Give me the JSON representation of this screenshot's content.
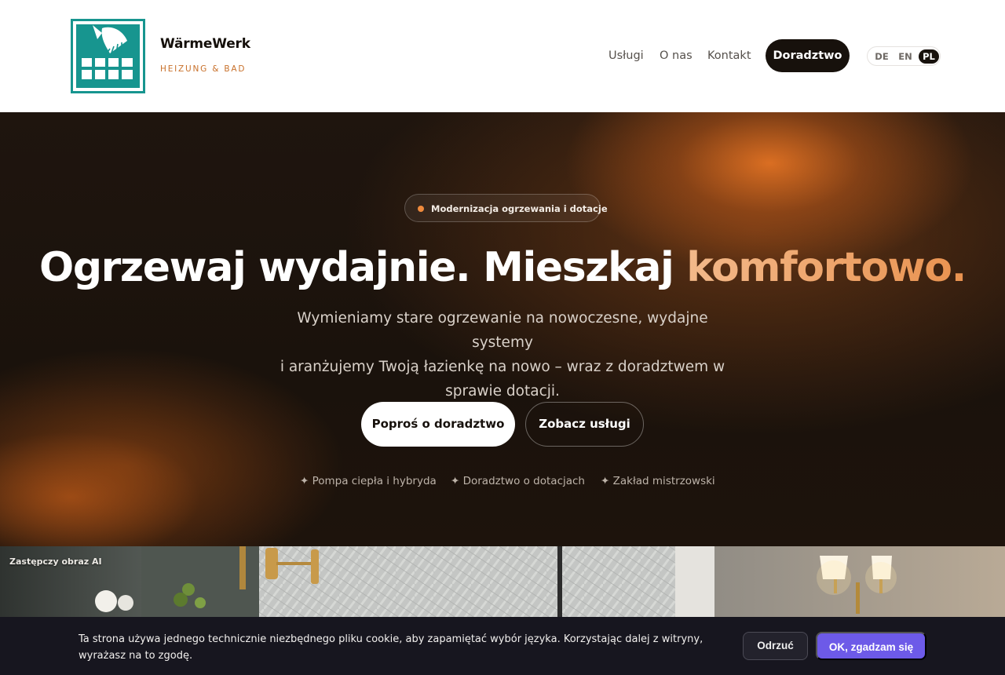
{
  "brand": {
    "name": "WärmeWerk",
    "tagline": "HEIZUNG & BAD",
    "accent_color": "#c8702a",
    "logo_color": "#17958f"
  },
  "nav": {
    "items": [
      {
        "label": "Usługi"
      },
      {
        "label": "O nas"
      },
      {
        "label": "Kontakt"
      }
    ],
    "cta_label": "Doradztwo",
    "languages": [
      "DE",
      "EN",
      "PL"
    ],
    "active_language": "PL"
  },
  "hero": {
    "badge": "Modernizacja ogrzewania i dotacje",
    "headline_main": "Ogrzewaj wydajnie. Mieszkaj ",
    "headline_accent": "komfortowo.",
    "subtitle_lines": [
      "Wymieniamy stare ogrzewanie na nowoczesne, wydajne systemy",
      "i aranżujemy Twoją łazienkę na nowo – wraz z doradztwem w",
      "sprawie dotacji."
    ],
    "primary_button": "Poproś o doradztwo",
    "secondary_button": "Zobacz usługi",
    "features": [
      "✦ Pompa ciepła i hybryda",
      "✦ Doradztwo o dotacjach",
      "✦ Zakład mistrzowski"
    ]
  },
  "photo": {
    "label": "Zastępczy obraz AI"
  },
  "cookie": {
    "text": "Ta strona używa jednego technicznie niezbędnego pliku cookie, aby zapamiętać wybór języka. Korzystając dalej z witryny, wyrażasz na to zgodę.",
    "reject_label": "Odrzuć",
    "accept_label": "OK, zgadzam się",
    "accept_color": "#6d5ae8"
  }
}
